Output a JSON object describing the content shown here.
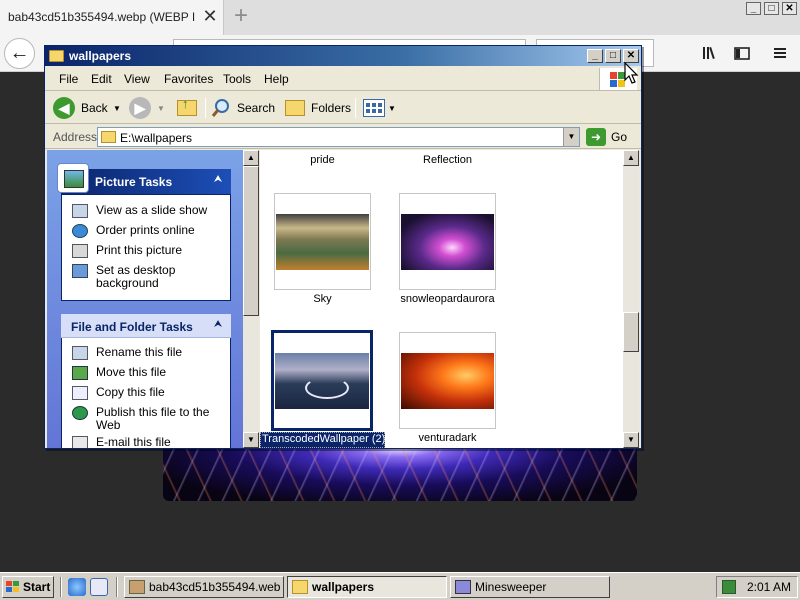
{
  "browser": {
    "tab_title": "bab43cd51b355494.webp (WEBP Image",
    "tab_close": "✕",
    "new_tab": "+",
    "back_icon": "←",
    "window_controls": {
      "minimize": "_",
      "maximize": "□",
      "close": "✕"
    },
    "toolbar_icons": [
      "library-icon",
      "sidebar-icon",
      "menu-icon"
    ]
  },
  "explorer": {
    "title": "wallpapers",
    "title_controls": {
      "minimize": "_",
      "maximize": "□",
      "close": "✕"
    },
    "menu": [
      "File",
      "Edit",
      "View",
      "Favorites",
      "Tools",
      "Help"
    ],
    "toolbar": {
      "back": "Back",
      "search": "Search",
      "folders": "Folders"
    },
    "address": {
      "label": "Address",
      "value": "E:\\wallpapers",
      "go": "Go"
    },
    "picture_tasks": {
      "title": "Picture Tasks",
      "items": [
        {
          "label": "View as a slide show",
          "icon": "slideshow-icon"
        },
        {
          "label": "Order prints online",
          "icon": "globe-icon"
        },
        {
          "label": "Print this picture",
          "icon": "printer-icon"
        },
        {
          "label": "Set as desktop background",
          "icon": "desktop-icon"
        }
      ]
    },
    "file_folder_tasks": {
      "title": "File and Folder Tasks",
      "items": [
        {
          "label": "Rename this file",
          "icon": "rename-icon"
        },
        {
          "label": "Move this file",
          "icon": "move-icon"
        },
        {
          "label": "Copy this file",
          "icon": "copy-icon"
        },
        {
          "label": "Publish this file to the Web",
          "icon": "web-icon"
        },
        {
          "label": "E-mail this file",
          "icon": "email-icon"
        }
      ]
    },
    "files": [
      {
        "name": "pride",
        "partial": true
      },
      {
        "name": "Reflection",
        "partial": true
      },
      {
        "name": "Sky",
        "thumb": "sky"
      },
      {
        "name": "snowleopardaurora",
        "thumb": "aurora"
      },
      {
        "name": "TranscodedWallpaper (2)",
        "thumb": "road",
        "selected": true
      },
      {
        "name": "venturadark",
        "thumb": "ventura"
      }
    ]
  },
  "taskbar": {
    "start": "Start",
    "tasks": [
      {
        "label": "bab43cd51b355494.web...",
        "icon": "firefox-icon",
        "active": false
      },
      {
        "label": "wallpapers",
        "icon": "folder-icon",
        "active": true
      },
      {
        "label": "Minesweeper",
        "icon": "minesweeper-icon",
        "active": false
      }
    ],
    "clock": "2:01 AM"
  },
  "colors": {
    "title_active": "#0a246a",
    "selection": "#0a246a",
    "taskbar": "#d4d0c8",
    "page_bg": "#2b2b2b"
  }
}
